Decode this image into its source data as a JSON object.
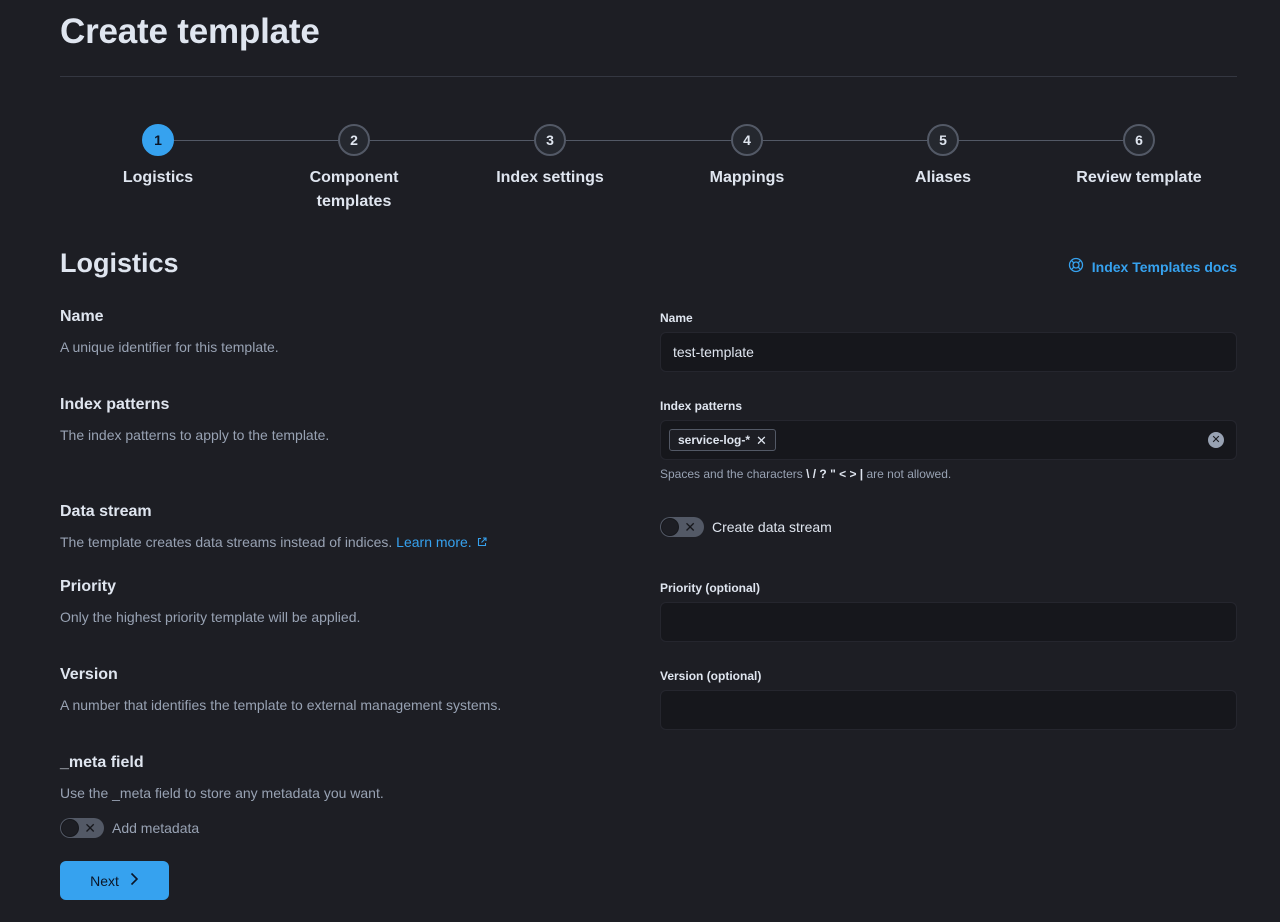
{
  "header": {
    "title": "Create template"
  },
  "steps": [
    {
      "number": "1",
      "label": "Logistics",
      "active": true
    },
    {
      "number": "2",
      "label": "Component templates",
      "active": false
    },
    {
      "number": "3",
      "label": "Index settings",
      "active": false
    },
    {
      "number": "4",
      "label": "Mappings",
      "active": false
    },
    {
      "number": "5",
      "label": "Aliases",
      "active": false
    },
    {
      "number": "6",
      "label": "Review template",
      "active": false
    }
  ],
  "section": {
    "title": "Logistics",
    "docs_link": "Index Templates docs",
    "docs_icon": "lifebuoy-icon"
  },
  "fields": {
    "name": {
      "title": "Name",
      "description": "A unique identifier for this template.",
      "label": "Name",
      "value": "test-template"
    },
    "index_patterns": {
      "title": "Index patterns",
      "description": "The index patterns to apply to the template.",
      "label": "Index patterns",
      "chips": [
        "service-log-*"
      ],
      "help_prefix": "Spaces and the characters ",
      "help_chars": "\\ / ? \" < > |",
      "help_suffix": " are not allowed."
    },
    "data_stream": {
      "title": "Data stream",
      "description": "The template creates data streams instead of indices.",
      "link": "Learn more.",
      "toggle_label": "Create data stream",
      "enabled": false
    },
    "priority": {
      "title": "Priority",
      "description": "Only the highest priority template will be applied.",
      "label": "Priority (optional)",
      "value": ""
    },
    "version": {
      "title": "Version",
      "description": "A number that identifies the template to external management systems.",
      "label": "Version (optional)",
      "value": ""
    },
    "meta": {
      "title": "_meta field",
      "description": "Use the _meta field to store any metadata you want.",
      "toggle_label": "Add metadata",
      "enabled": false
    }
  },
  "actions": {
    "next_label": "Next"
  },
  "colors": {
    "accent": "#36a2ef",
    "background": "#1d1e24",
    "input_bg": "#16171c"
  }
}
